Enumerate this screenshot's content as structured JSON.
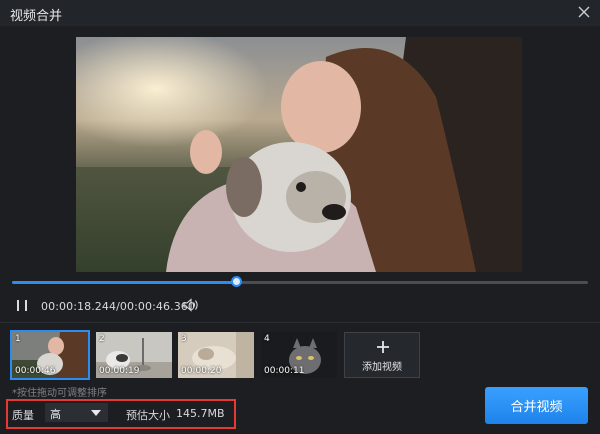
{
  "window": {
    "title": "视频合并"
  },
  "player": {
    "current_time": "00:00:18.244",
    "total_time": "00:00:46.360",
    "time_display": "00:00:18.244/00:00:46.360",
    "progress_fraction": 0.391
  },
  "clips": [
    {
      "index": "1",
      "duration": "00:00:46",
      "selected": true
    },
    {
      "index": "2",
      "duration": "00:00:19",
      "selected": false
    },
    {
      "index": "3",
      "duration": "00:00:20",
      "selected": false
    },
    {
      "index": "4",
      "duration": "00:00:11",
      "selected": false
    }
  ],
  "add_video_label": "添加视频",
  "hint": "*按住拖动可调整排序",
  "quality": {
    "label": "质量",
    "value": "高"
  },
  "estimate": {
    "label": "预估大小",
    "value": "145.7MB"
  },
  "merge_button": "合并视频",
  "colors": {
    "accent": "#2d8cf0",
    "highlight_box": "#e53935",
    "background": "#1c1e22"
  },
  "icons": [
    "close-icon",
    "pause-icon",
    "volume-icon",
    "plus-icon",
    "chevron-down-icon"
  ]
}
